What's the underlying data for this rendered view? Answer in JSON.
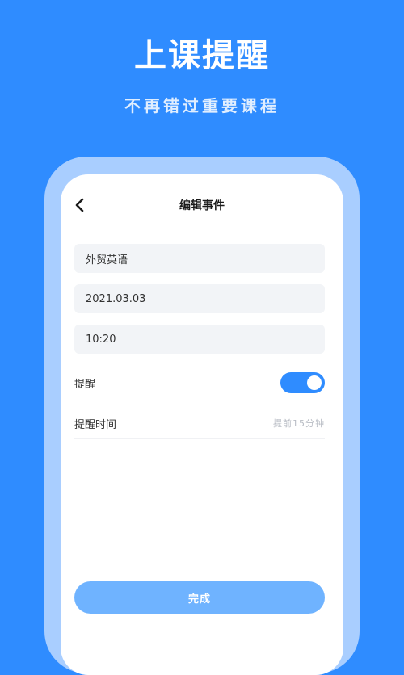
{
  "hero": {
    "title": "上课提醒",
    "subtitle": "不再错过重要课程"
  },
  "nav": {
    "title": "编辑事件",
    "back_icon": "chevron-left-icon"
  },
  "form": {
    "course_name": "外贸英语",
    "date": "2021.03.03",
    "time": "10:20",
    "reminder_label": "提醒",
    "reminder_enabled": true,
    "reminder_time_label": "提醒时间",
    "reminder_time_value": "提前15分钟"
  },
  "done_label": "完成",
  "colors": {
    "background": "#2f8cff",
    "toggle_on": "#2f8cff",
    "done_button": "#6fb3ff"
  }
}
